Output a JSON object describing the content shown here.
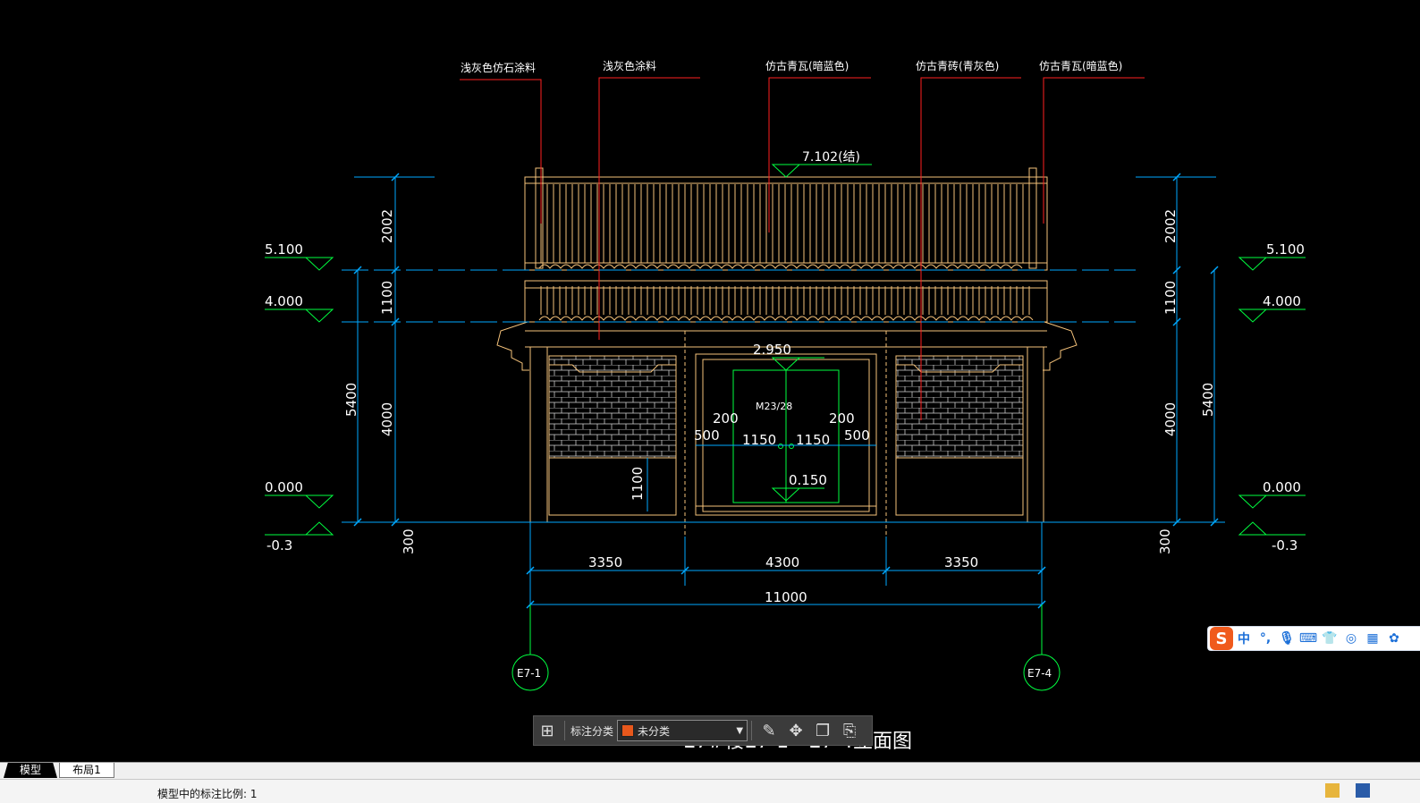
{
  "drawing": {
    "material_labels": [
      "浅灰色仿石涂料",
      "浅灰色涂料",
      "仿古青瓦(暗蓝色)",
      "仿古青砖(青灰色)",
      "仿古青瓦(暗蓝色)"
    ],
    "ridge_elev": "7.102(结)",
    "left_elevations": [
      "5.100",
      "4.000",
      "0.000",
      "-0.3"
    ],
    "right_elevations": [
      "5.100",
      "4.000",
      "0.000",
      "-0.3"
    ],
    "vertical_dims": {
      "d2002": "2002",
      "d1100": "1100",
      "d4000": "4000",
      "d5400": "5400",
      "d300": "300"
    },
    "door": {
      "elev_top": "2.950",
      "tag": "M23/28",
      "elev_bottom": "0.150",
      "dim_200": "200",
      "dim_500": "500",
      "dim_1150": "1150"
    },
    "sill_dim": "1100",
    "horizontal_dims": [
      "3350",
      "4300",
      "3350"
    ],
    "total_dim": "11000",
    "axis_left": "E7-1",
    "axis_right": "E7-4",
    "title": "E7#楼E7-1～E7-4立面图"
  },
  "anno_toolbar": {
    "label": "标注分类",
    "selected": "未分类"
  },
  "ime": {
    "logo": "S",
    "lang": "中",
    "punct": "°,"
  },
  "tabs": {
    "model": "模型",
    "layout1": "布局1"
  },
  "status": {
    "text": "模型中的标注比例: 1"
  },
  "colors": {
    "background": "#000000",
    "cad_line": "#f5c27a",
    "dim": "#00a8ff",
    "leader": "#ff2020",
    "elevation": "#00ff40",
    "door": "#00ff40",
    "annotation_text": "#ffffff"
  }
}
